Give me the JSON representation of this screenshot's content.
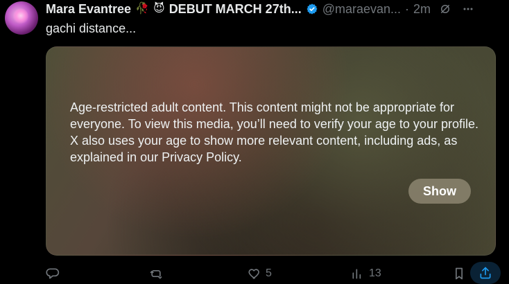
{
  "tweet": {
    "author_name": "Mara Evantree",
    "author_emoji_1": "🥀",
    "author_emoji_2": "😈",
    "author_tagline": "DEBUT MARCH 27th...",
    "handle": "@maraevan...",
    "separator": "·",
    "time": "2m",
    "text": "gachi distance...",
    "media": {
      "warning": "Age-restricted adult content. This content might not be appropriate for everyone. To view this media, you’ll need to verify your age to your profile. X also uses your age to show more relevant content, including ads, as explained in our Privacy Policy.",
      "show_label": "Show"
    },
    "stats": {
      "likes": "5",
      "views": "13"
    }
  },
  "icons": {
    "verified": "verified-badge-icon",
    "grok": "grok-icon",
    "more": "more-icon",
    "reply": "reply-icon",
    "retweet": "retweet-icon",
    "like": "heart-icon",
    "views": "views-icon",
    "bookmark": "bookmark-icon",
    "share": "share-icon"
  },
  "colors": {
    "background": "#000000",
    "text": "#e7e9ea",
    "muted": "#71767b",
    "accent": "#1d9bf0"
  }
}
